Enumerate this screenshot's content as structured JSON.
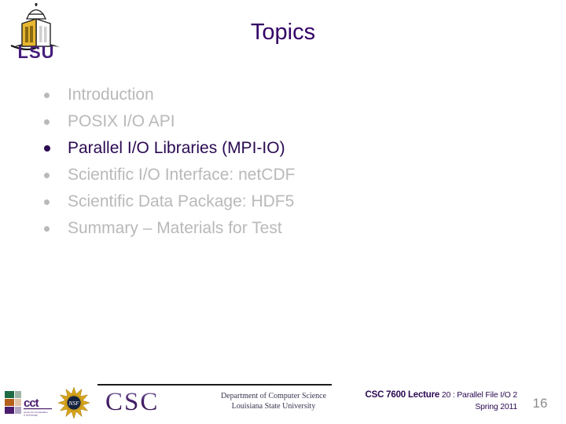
{
  "slide": {
    "title": "Topics",
    "title_color": "#330066",
    "active_color": "#2b0a52",
    "dim_color": "#b9b9b9",
    "background_color": "#ffffff"
  },
  "brand": {
    "lsu_wordmark": "LSU",
    "lsu_icon": "lsu-campanile-tower-icon",
    "cct_wordmark": "cct",
    "cct_subtitle": "center for computation & technology",
    "nsf_wordmark": "NSF",
    "csc_wordmark": "CSC",
    "csc_dept_line1": "Department of Computer Science",
    "csc_dept_line2": "Louisiana State University"
  },
  "topics": [
    {
      "label": "Introduction",
      "state": "dim"
    },
    {
      "label": "POSIX I/O API",
      "state": "dim"
    },
    {
      "label": "Parallel I/O Libraries (MPI-IO)",
      "state": "active"
    },
    {
      "label": "Scientific I/O Interface: netCDF",
      "state": "dim"
    },
    {
      "label": "Scientific Data Package: HDF5",
      "state": "dim"
    },
    {
      "label": "Summary – Materials for Test",
      "state": "dim"
    }
  ],
  "footer": {
    "course_bold": "CSC 7600 Lecture",
    "lecture_detail": " 20 : Parallel File I/O 2",
    "term": "Spring 2011",
    "page_number": "16"
  }
}
